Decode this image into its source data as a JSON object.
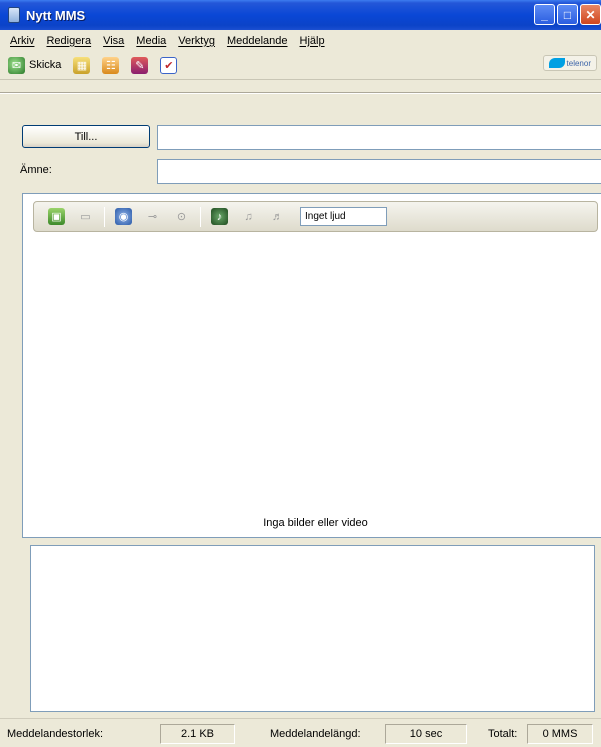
{
  "window": {
    "title": "Nytt MMS",
    "min": "_",
    "max": "□",
    "close": "✕"
  },
  "menu": [
    "Arkiv",
    "Redigera",
    "Visa",
    "Media",
    "Verktyg",
    "Meddelande",
    "Hjälp"
  ],
  "toolbar": {
    "send_label": "Skicka",
    "brand_text": "telenor"
  },
  "recipient": {
    "to_button": "Till...",
    "to_value": "",
    "subject_label": "Ämne:",
    "subject_value": ""
  },
  "slide": {
    "sound_value": "Inget ljud",
    "empty_text": "Inga bilder eller video"
  },
  "message": {
    "body": ""
  },
  "status": {
    "size_label": "Meddelandestorlek:",
    "size_value": "2.1 KB",
    "length_label": "Meddelandelängd:",
    "length_value": "10 sec",
    "total_label": "Totalt:",
    "total_value": "0 MMS"
  },
  "colors": {
    "titlebar": "#0a47d6",
    "accent": "#00a0e3"
  }
}
